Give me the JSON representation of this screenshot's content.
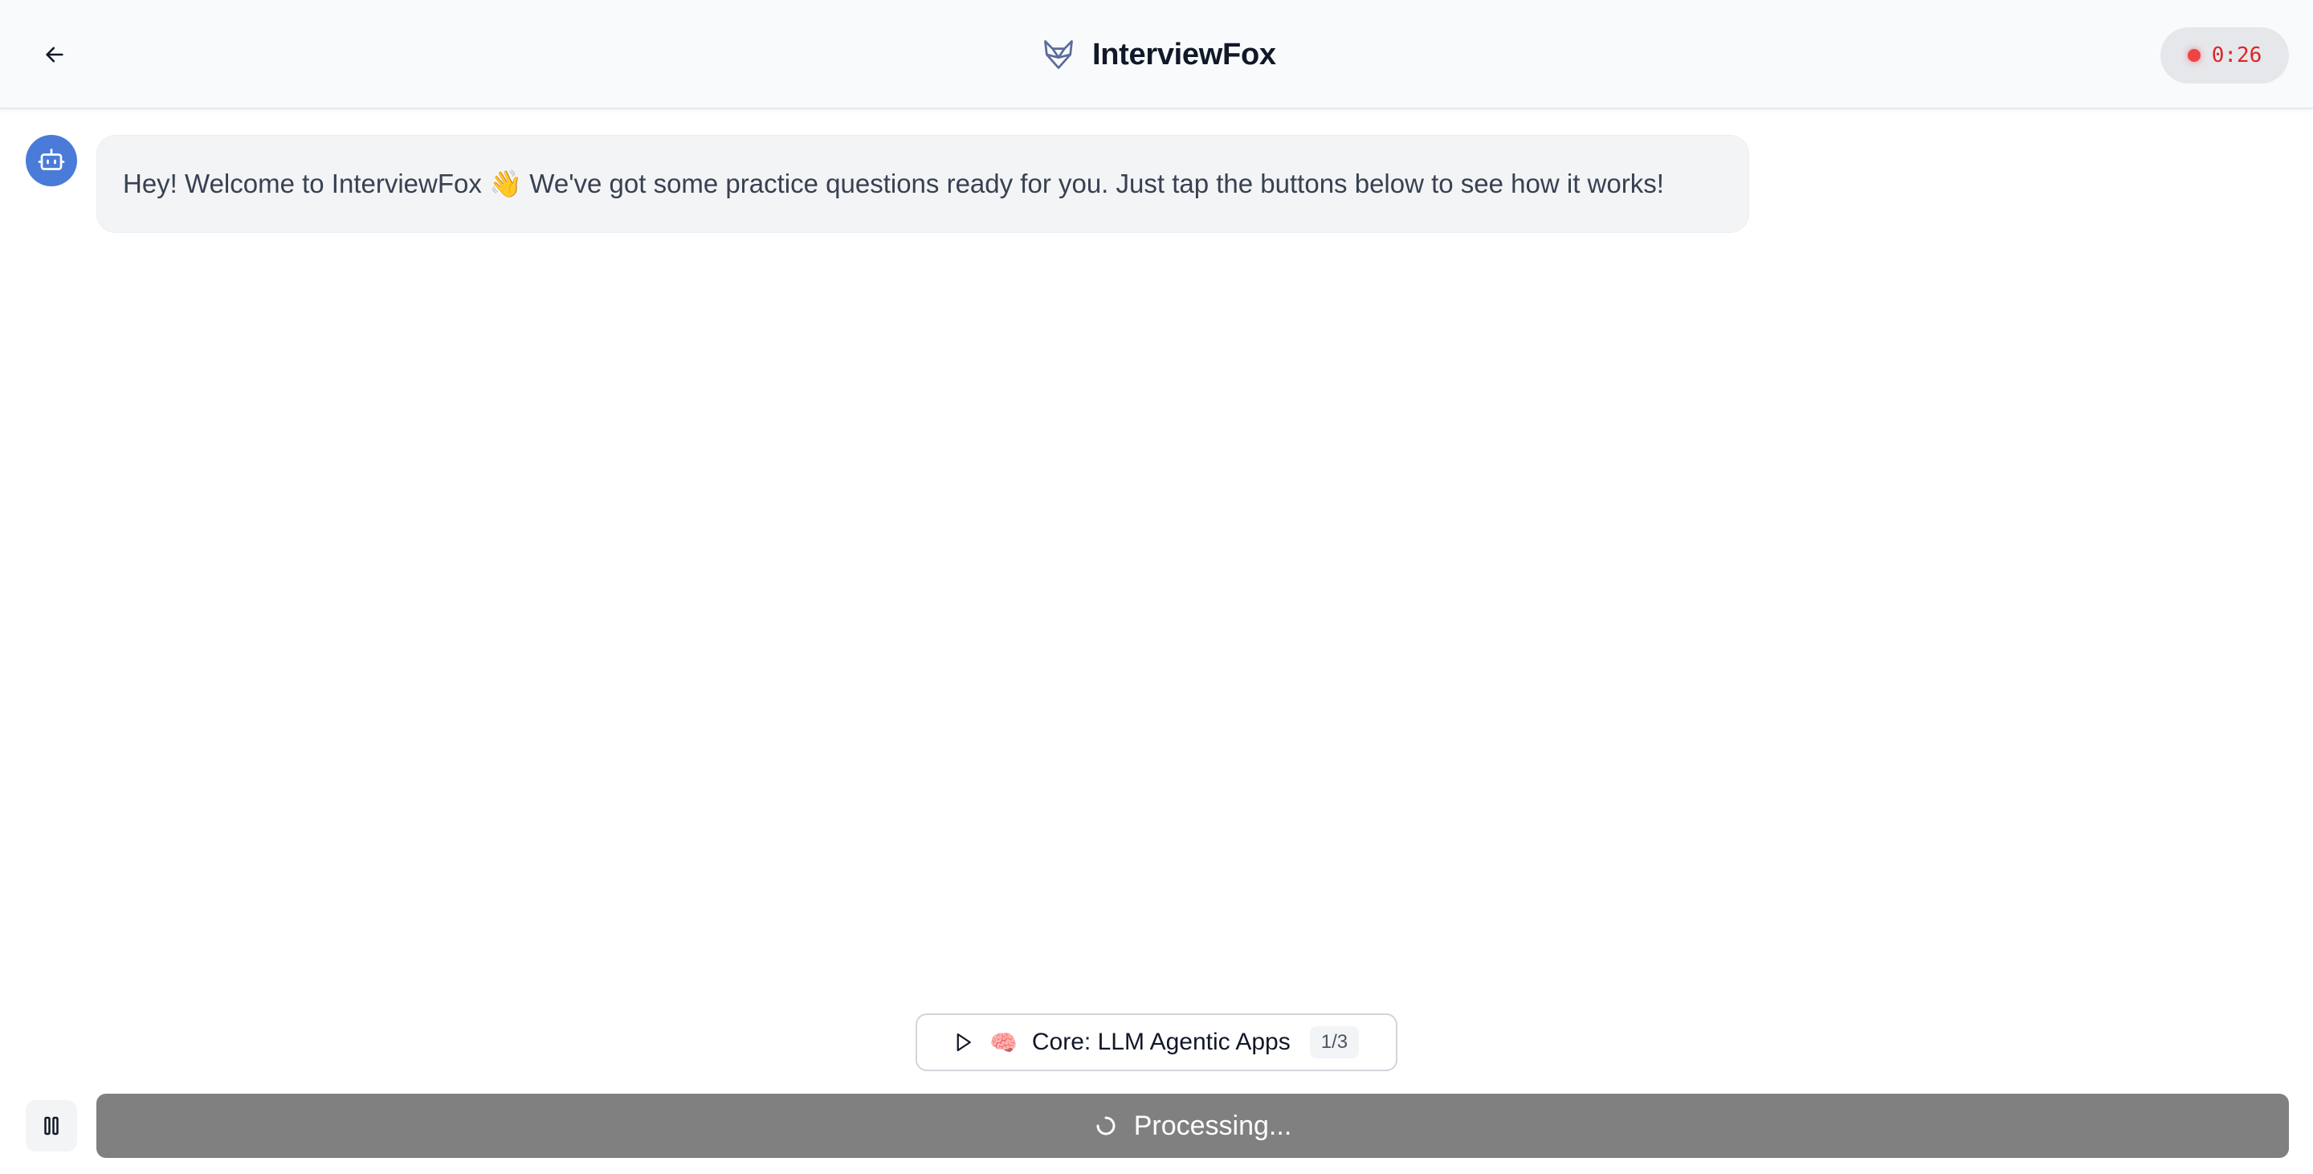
{
  "header": {
    "back_icon": "arrow-left-icon",
    "brand_icon": "fox-icon",
    "title": "InterviewFox",
    "timer": {
      "value": "0:26",
      "status_color": "#ef4444"
    }
  },
  "chat": {
    "messages": [
      {
        "sender_icon": "robot-icon",
        "text": "Hey! Welcome to InterviewFox 👋 We've got some practice questions ready for you. Just tap the buttons below to see how it works!"
      }
    ]
  },
  "topic": {
    "play_icon": "play-icon",
    "emoji": "🧠",
    "label": "Core: LLM Agentic Apps",
    "count": "1/3"
  },
  "footer": {
    "pause_icon": "pause-icon",
    "spinner_icon": "spinner-icon",
    "processing_label": "Processing..."
  },
  "colors": {
    "accent": "#4a7bd8",
    "processing_bg": "#808080",
    "recording": "#ef4444"
  }
}
